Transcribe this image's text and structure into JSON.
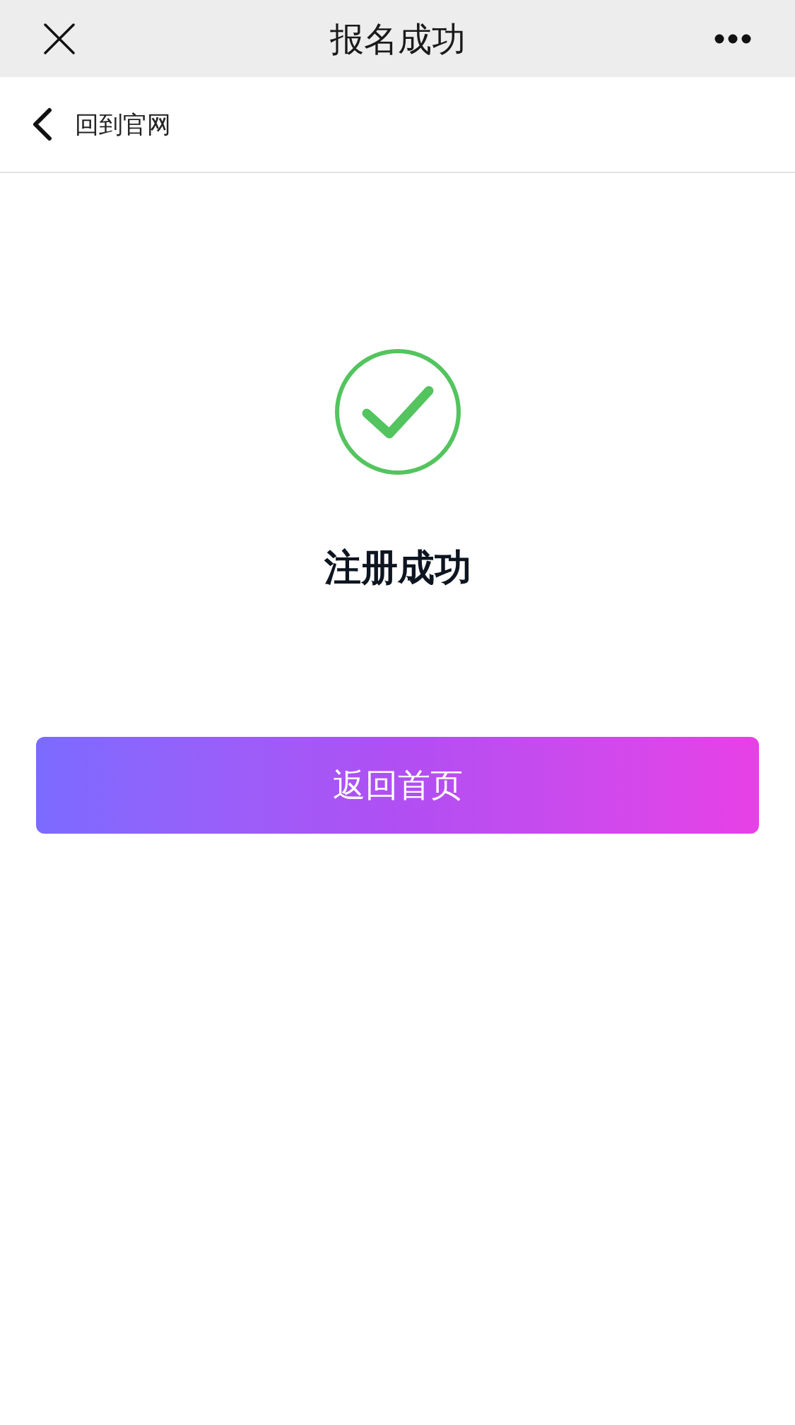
{
  "top_bar": {
    "title": "报名成功"
  },
  "nav": {
    "back_label": "回到官网"
  },
  "result": {
    "kind": "success",
    "message": "注册成功"
  },
  "buttons": [
    {
      "label": "返回首页"
    }
  ]
}
